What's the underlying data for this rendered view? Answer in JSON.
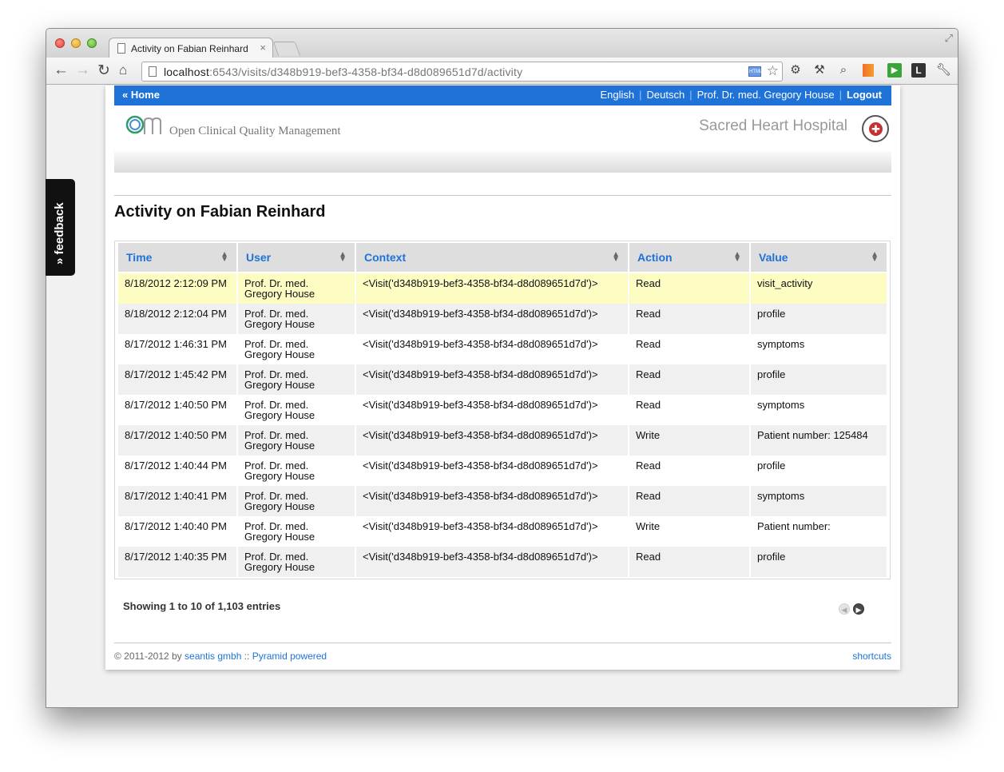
{
  "browser": {
    "tab_title": "Activity on Fabian Reinhard",
    "tab_close": "×",
    "url_host": "localhost",
    "url_rest": ":6543/visits/d348b919-bef3-4358-bf34-d8d089651d7d/activity"
  },
  "feedback": {
    "label": "» feedback"
  },
  "topnav": {
    "home": "« Home",
    "english": "English",
    "deutsch": "Deutsch",
    "user": "Prof. Dr. med. Gregory House",
    "logout": "Logout"
  },
  "brand": {
    "app_name": "Open Clinical Quality Management",
    "hospital": "Sacred Heart Hospital"
  },
  "page": {
    "title": "Activity on Fabian Reinhard"
  },
  "table": {
    "headers": {
      "time": "Time",
      "user": "User",
      "context": "Context",
      "action": "Action",
      "value": "Value"
    },
    "rows": [
      {
        "time": "8/18/2012 2:12:09 PM",
        "user": "Prof. Dr. med. Gregory House",
        "context": "<Visit('d348b919-bef3-4358-bf34-d8d089651d7d')>",
        "action": "Read",
        "value": "visit_activity"
      },
      {
        "time": "8/18/2012 2:12:04 PM",
        "user": "Prof. Dr. med. Gregory House",
        "context": "<Visit('d348b919-bef3-4358-bf34-d8d089651d7d')>",
        "action": "Read",
        "value": "profile"
      },
      {
        "time": "8/17/2012 1:46:31 PM",
        "user": "Prof. Dr. med. Gregory House",
        "context": "<Visit('d348b919-bef3-4358-bf34-d8d089651d7d')>",
        "action": "Read",
        "value": "symptoms"
      },
      {
        "time": "8/17/2012 1:45:42 PM",
        "user": "Prof. Dr. med. Gregory House",
        "context": "<Visit('d348b919-bef3-4358-bf34-d8d089651d7d')>",
        "action": "Read",
        "value": "profile"
      },
      {
        "time": "8/17/2012 1:40:50 PM",
        "user": "Prof. Dr. med. Gregory House",
        "context": "<Visit('d348b919-bef3-4358-bf34-d8d089651d7d')>",
        "action": "Read",
        "value": "symptoms"
      },
      {
        "time": "8/17/2012 1:40:50 PM",
        "user": "Prof. Dr. med. Gregory House",
        "context": "<Visit('d348b919-bef3-4358-bf34-d8d089651d7d')>",
        "action": "Write",
        "value": "Patient number: 125484"
      },
      {
        "time": "8/17/2012 1:40:44 PM",
        "user": "Prof. Dr. med. Gregory House",
        "context": "<Visit('d348b919-bef3-4358-bf34-d8d089651d7d')>",
        "action": "Read",
        "value": "profile"
      },
      {
        "time": "8/17/2012 1:40:41 PM",
        "user": "Prof. Dr. med. Gregory House",
        "context": "<Visit('d348b919-bef3-4358-bf34-d8d089651d7d')>",
        "action": "Read",
        "value": "symptoms"
      },
      {
        "time": "8/17/2012 1:40:40 PM",
        "user": "Prof. Dr. med. Gregory House",
        "context": "<Visit('d348b919-bef3-4358-bf34-d8d089651d7d')>",
        "action": "Write",
        "value": "Patient number:"
      },
      {
        "time": "8/17/2012 1:40:35 PM",
        "user": "Prof. Dr. med. Gregory House",
        "context": "<Visit('d348b919-bef3-4358-bf34-d8d089651d7d')>",
        "action": "Read",
        "value": "profile"
      }
    ],
    "info": "Showing 1 to 10 of 1,103 entries"
  },
  "footer": {
    "copyright": "© 2011-2012 by ",
    "company": "seantis gmbh",
    "sep": " :: ",
    "powered": "Pyramid powered",
    "shortcuts": "shortcuts"
  },
  "colors": {
    "accent": "#1e72d8",
    "highlight_row": "#fdfcc2",
    "header_bg": "#dedede"
  }
}
